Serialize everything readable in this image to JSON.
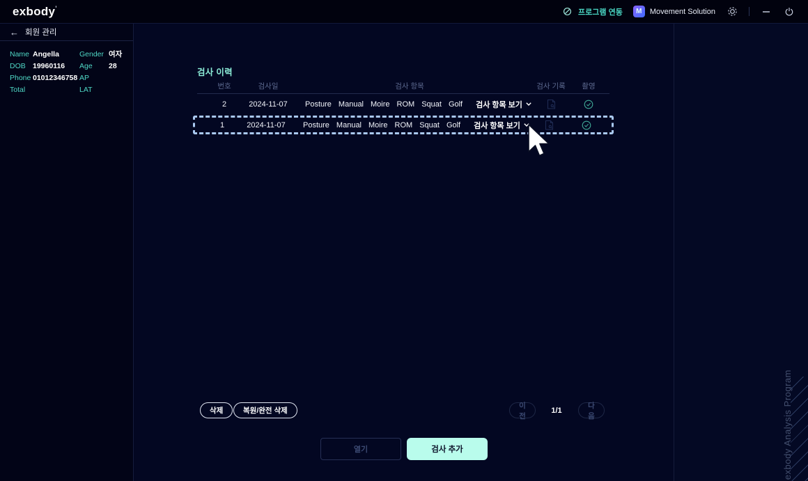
{
  "topbar": {
    "logo": "exbody",
    "logo_mark": "'",
    "program_link_label": "프로그램 연동",
    "app_badge_letter": "M",
    "app_name": "Movement Solution"
  },
  "sidebar": {
    "back_arrow": "←",
    "back_label": "회원 관리",
    "patient": [
      {
        "label": "Name",
        "value": "Angella"
      },
      {
        "label": "Gender",
        "value": "여자"
      },
      {
        "label": "DOB",
        "value": "19960116"
      },
      {
        "label": "Age",
        "value": "28"
      },
      {
        "label": "Phone",
        "value": "01012346758"
      },
      {
        "label": "AP",
        "value": ""
      },
      {
        "label": "Total",
        "value": ""
      },
      {
        "label": "LAT",
        "value": ""
      }
    ]
  },
  "main": {
    "section_title": "검사 이력",
    "table": {
      "headers": [
        "번호",
        "검사일",
        "검사 항목",
        "검사 기록",
        "촬영"
      ],
      "rows": [
        {
          "no": "2",
          "date": "2024-11-07",
          "items": [
            "Posture",
            "Manual",
            "Moire",
            "ROM",
            "Squat",
            "Golf"
          ],
          "dropdown_label": "검사 항목 보기",
          "selected": false
        },
        {
          "no": "1",
          "date": "2024-11-07",
          "items": [
            "Posture",
            "Manual",
            "Moire",
            "ROM",
            "Squat",
            "Golf"
          ],
          "dropdown_label": "검사 항목 보기",
          "selected": true
        }
      ]
    },
    "actions": {
      "delete_label": "삭제",
      "restore_delete_label": "복원/완전 삭제"
    },
    "pagination": {
      "prev_label": "이전",
      "page_indicator": "1/1",
      "next_label": "다음"
    },
    "footer_buttons": {
      "open_label": "열기",
      "add_exam_label": "검사 추가"
    }
  },
  "right_panel": {
    "watermark": "exbody Analysis Program"
  },
  "colors": {
    "background": "#030722",
    "topbar_bg": "#01020e",
    "sidebar_bg": "#020417",
    "accent_teal": "#49d6c3",
    "title_mint": "#8becd7",
    "add_button_mint": "#b9fcec",
    "selected_row_border": "#a9c8f0",
    "check_icon": "#3fa795",
    "dim_text": "#5d6a90",
    "app_badge_gradient": "#8a63ff,#3f6dff"
  }
}
